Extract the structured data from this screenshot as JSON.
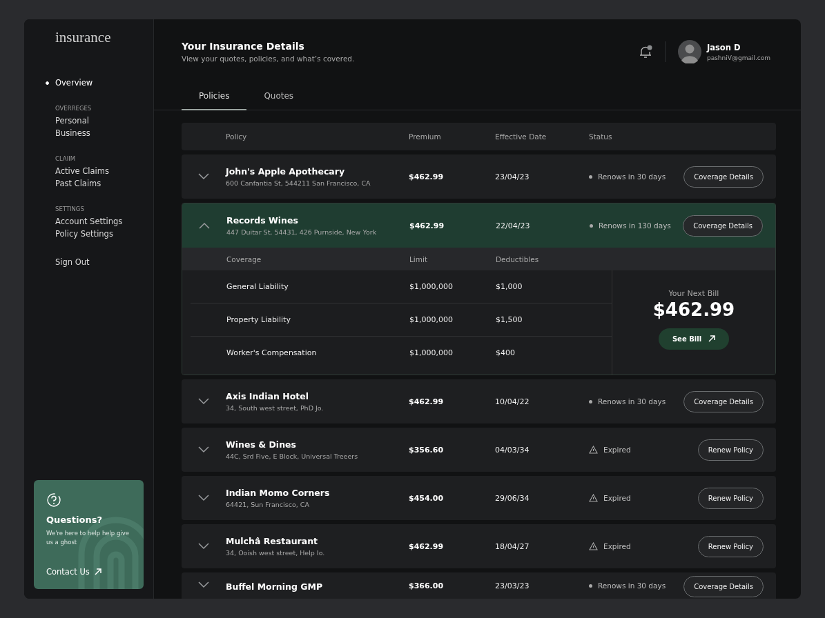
{
  "sidebar": {
    "logo": "insurance",
    "nav": [
      {
        "label": "Overview",
        "selected": true
      }
    ],
    "sections": [
      {
        "title": "OVERREGES",
        "items": [
          {
            "label": "Personal",
            "selected": false
          },
          {
            "label": "Business",
            "selected": false
          }
        ]
      },
      {
        "title": "CLAIIM",
        "items": [
          {
            "label": "Active Claims",
            "selected": false
          },
          {
            "label": "Past Claims",
            "selected": false
          }
        ]
      },
      {
        "title": "SETTINGS",
        "items": [
          {
            "label": "Account Settings",
            "selected": false
          },
          {
            "label": "Policy Settings",
            "selected": false
          }
        ]
      }
    ],
    "sign_out": "Sign Out",
    "help": {
      "title": "Questions?",
      "text": "We're here to help help give us a ghost",
      "link": "Contact Us"
    }
  },
  "header": {
    "title": "Your Insurance Details",
    "subtitle": "View your quotes, policies, and what’s covered.",
    "user": {
      "name": "Jason D",
      "email": "pashniV@gmail.com"
    }
  },
  "tabs": [
    {
      "label": "Policies",
      "selected": true
    },
    {
      "label": "Quotes",
      "selected": false
    }
  ],
  "table": {
    "columns": [
      "Policy",
      "Premium",
      "Effective Date",
      "Status"
    ],
    "rows": [
      {
        "name": "John's Apple Apothecary",
        "address": "600 Canfantia St, 544211 San Francisco, CA",
        "premium": "$462.99",
        "date": "23/04/23",
        "kind": "renewing",
        "status": "Renows in 30 days",
        "action": "Coverage Details",
        "expanded": false
      },
      {
        "name": "Records Wines",
        "address": "447 Duitar St, 54431, 426 Purnside, New York",
        "premium": "$462.99",
        "date": "22/04/23",
        "kind": "renewing",
        "status": "Renows in 130 days",
        "action": "Coverage Details",
        "expanded": true,
        "coverage": {
          "columns": [
            "Coverage",
            "Limit",
            "Deductibles"
          ],
          "rows": [
            [
              "General Liability",
              "$1,000,000",
              "$1,000"
            ],
            [
              "Property Liability",
              "$1,000,000",
              "$1,500"
            ],
            [
              "Worker's Compensation",
              "$1,000,000",
              "$400"
            ]
          ],
          "bill_label": "Your Next Bill",
          "bill_amount": "$462.99",
          "bill_button": "See Bill"
        }
      },
      {
        "name": "Axis Indian Hotel",
        "address": "34, South west street, PhD Jo.",
        "premium": "$462.99",
        "date": "10/04/22",
        "kind": "renewing",
        "status": "Renows in 30 days",
        "action": "Coverage Details",
        "expanded": false
      },
      {
        "name": "Wines & Dines",
        "address": "44C, Srd Five, E Block, Universal Treeers",
        "premium": "$356.60",
        "date": "04/03/34",
        "kind": "expired",
        "status": "Expired",
        "action": "Renew Policy",
        "expanded": false
      },
      {
        "name": "Indian Momo Corners",
        "address": "64421, Sun Francisco, CA",
        "premium": "$454.00",
        "date": "29/06/34",
        "kind": "expired",
        "status": "Expired",
        "action": "Renew Policy",
        "expanded": false
      },
      {
        "name": "Mulchâ Restaurant",
        "address": "34, Ooish west street, Help Io.",
        "premium": "$462.99",
        "date": "18/04/27",
        "kind": "expired",
        "status": "Expired",
        "action": "Renew Policy",
        "expanded": false
      },
      {
        "name": "Buffel Morning GMP",
        "premium": "$366.00",
        "date": "23/03/23",
        "kind": "renewing",
        "status": "Renows in 30 days",
        "action": "Coverage Details",
        "expanded": false
      }
    ]
  }
}
